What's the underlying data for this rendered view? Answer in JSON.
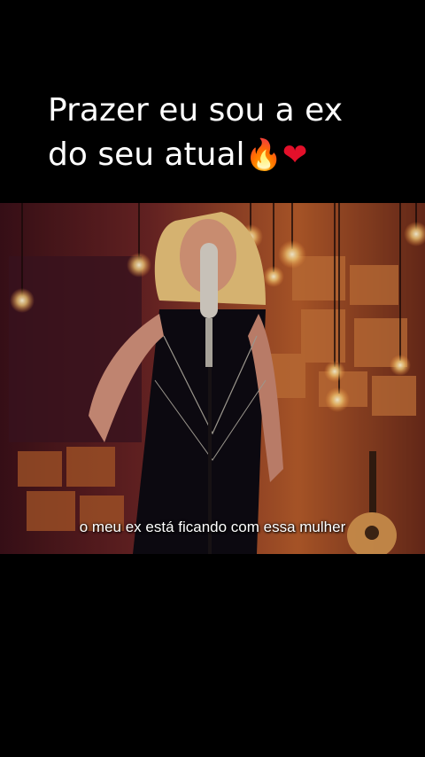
{
  "caption": {
    "line1": "Prazer eu sou a ex",
    "line2": "do seu atual",
    "emoji1": "🔥",
    "emoji2": "❤"
  },
  "video": {
    "subtitle": "o meu ex está ficando com essa mulher"
  }
}
